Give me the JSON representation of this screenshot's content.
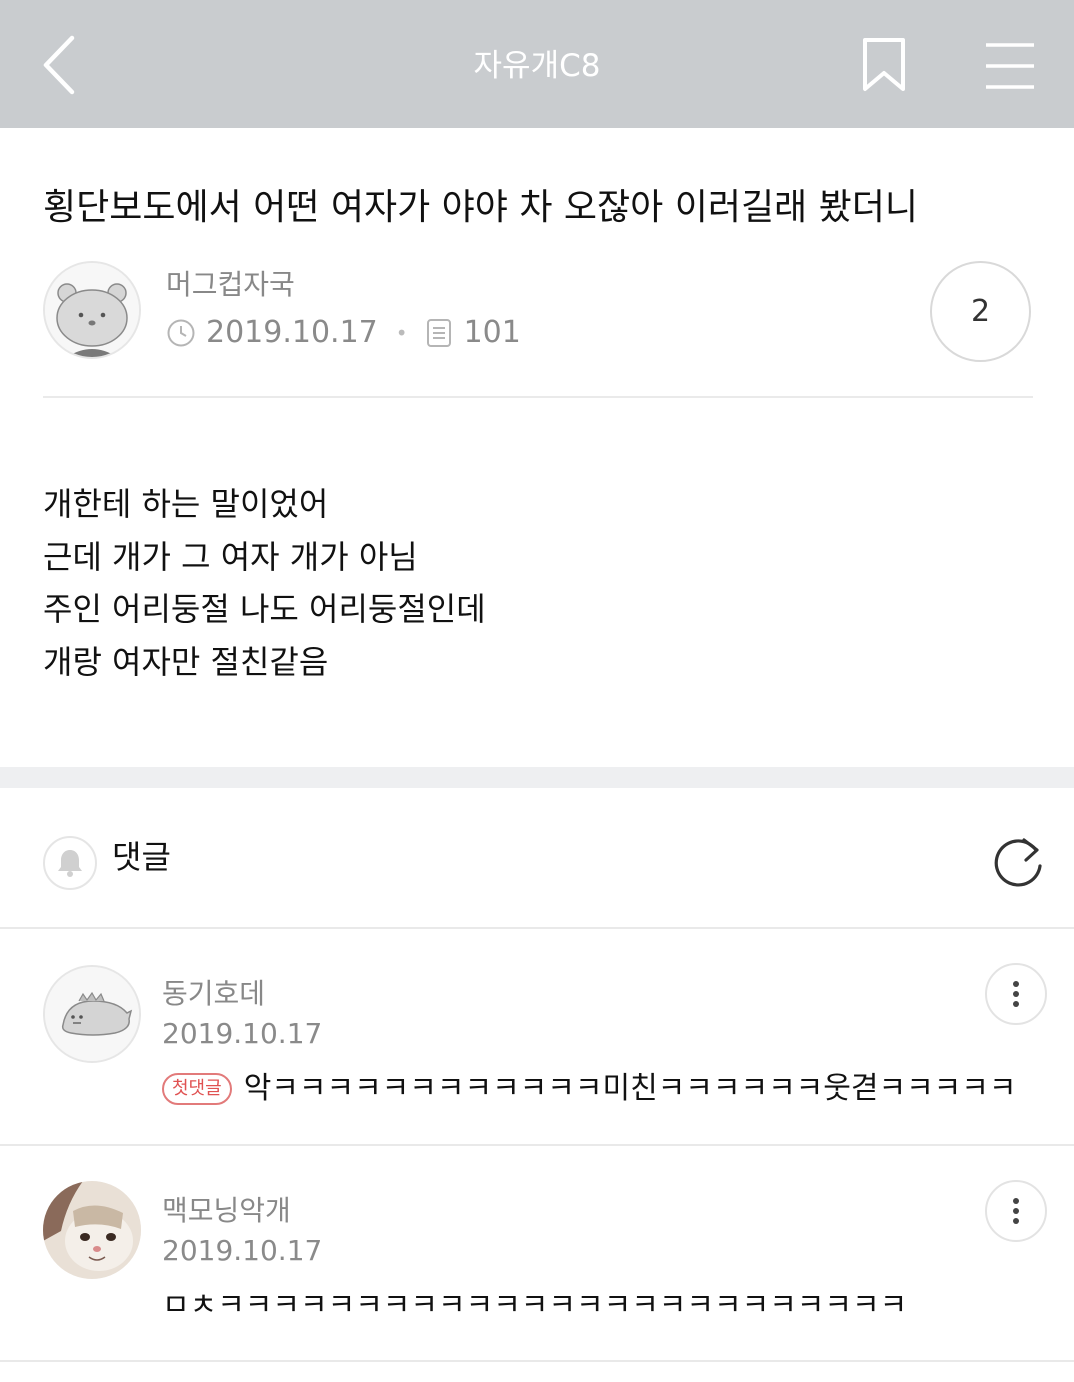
{
  "header": {
    "title": "자유개C8",
    "icons": [
      "back-arrow-icon",
      "bookmark-icon",
      "hamburger-menu-icon"
    ],
    "background": "#c9cccf"
  },
  "post": {
    "title": "횡단보도에서 어떤 여자가 야야 차 오잖아 이러길래 봤더니",
    "author": "머그컵자국",
    "date": "2019.10.17",
    "views": "101",
    "comment_count": "2",
    "body_lines": [
      "개한테 하는 말이었어",
      "근데 개가 그 여자 개가 아님",
      "주인 어리둥절 나도 어리둥절인데",
      "개랑 여자만 절친같음"
    ]
  },
  "comments_section": {
    "label": "댓글"
  },
  "comments": [
    {
      "author": "동기호데",
      "date": "2019.10.17",
      "badge": "첫댓글",
      "text": "악ㅋㅋㅋㅋㅋㅋㅋㅋㅋㅋㅋㅋ미친ㅋㅋㅋㅋㅋㅋ웃겯ㅋㅋㅋㅋㅋ"
    },
    {
      "author": "맥모닝악개",
      "date": "2019.10.17",
      "text": "ㅁㅊㅋㅋㅋㅋㅋㅋㅋㅋㅋㅋㅋㅋㅋㅋㅋㅋㅋㅋㅋㅋㅋㅋㅋㅋㅋ"
    }
  ],
  "colors": {
    "accent_badge": "#e05252",
    "divider": "#e9e9e9",
    "section_gap": "#eeeff1"
  }
}
